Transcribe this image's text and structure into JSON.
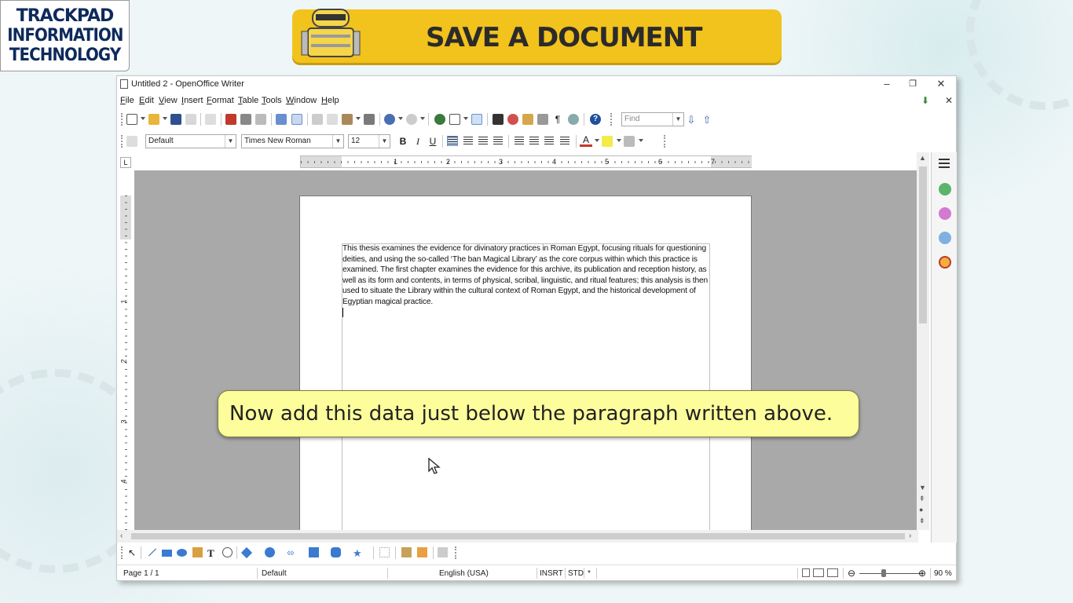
{
  "logo": {
    "line1": "TRACKPAD",
    "line2": "INFORMATION",
    "line3": "TECHNOLOGY"
  },
  "banner": {
    "title": "SAVE A DOCUMENT"
  },
  "window": {
    "title": "Untitled 2 - OpenOffice Writer",
    "controls": {
      "minimize": "–",
      "maximize": "❐",
      "close": "✕"
    }
  },
  "menu": {
    "items": [
      "File",
      "Edit",
      "View",
      "Insert",
      "Format",
      "Table",
      "Tools",
      "Window",
      "Help"
    ],
    "close_doc": "✕"
  },
  "toolbar": {
    "find_placeholder": "Find"
  },
  "formatting": {
    "style": "Default",
    "font": "Times New Roman",
    "size": "12",
    "bold": "B",
    "italic": "I",
    "underline": "U",
    "font_color_letter": "A"
  },
  "ruler": {
    "h_numbers": [
      "1",
      "2",
      "3",
      "4",
      "5",
      "6",
      "7"
    ],
    "v_numbers": [
      "1",
      "2",
      "3",
      "4"
    ],
    "corner": "L"
  },
  "document": {
    "paragraph": "This thesis examines the evidence for divinatory practices in Roman Egypt, focusing rituals for questioning deities, and using the so-called ‘The ban Magical Library’ as the core corpus within which this practice is examined. The first chapter examines the evidence for this archive, its publication and reception history, as well as its form and contents, in terms of physical, scribal, linguistic, and ritual features; this analysis is then used to situate the Library within the cultural context of Roman Egypt, and the historical development of Egyptian magical practice."
  },
  "status": {
    "page": "Page 1 / 1",
    "style": "Default",
    "language": "English (USA)",
    "insert_mode": "INSRT",
    "selection_mode": "STD",
    "modified": "*",
    "zoom": "90 %",
    "zoom_minus": "⊖",
    "zoom_plus": "⊕"
  },
  "caption": {
    "text": "Now add this data just below the paragraph written above."
  },
  "colors": {
    "banner": "#f2c21d",
    "caption": "#fdfd9c",
    "workspace": "#a9a9a9",
    "logo_text": "#0e2a5c"
  },
  "icons": [
    "new-icon",
    "open-icon",
    "save-icon",
    "email-icon",
    "edit-icon",
    "pdf-icon",
    "print-icon",
    "preview-icon",
    "spellcheck-icon",
    "autospell-icon",
    "cut-icon",
    "copy-icon",
    "paste-icon",
    "clone-icon",
    "undo-icon",
    "redo-icon",
    "hyperlink-icon",
    "table-icon",
    "draw-icon",
    "find-replace-icon",
    "navigator-icon",
    "gallery-icon",
    "datasource-icon",
    "nonprinting-icon",
    "zoom-icon",
    "help-icon"
  ]
}
